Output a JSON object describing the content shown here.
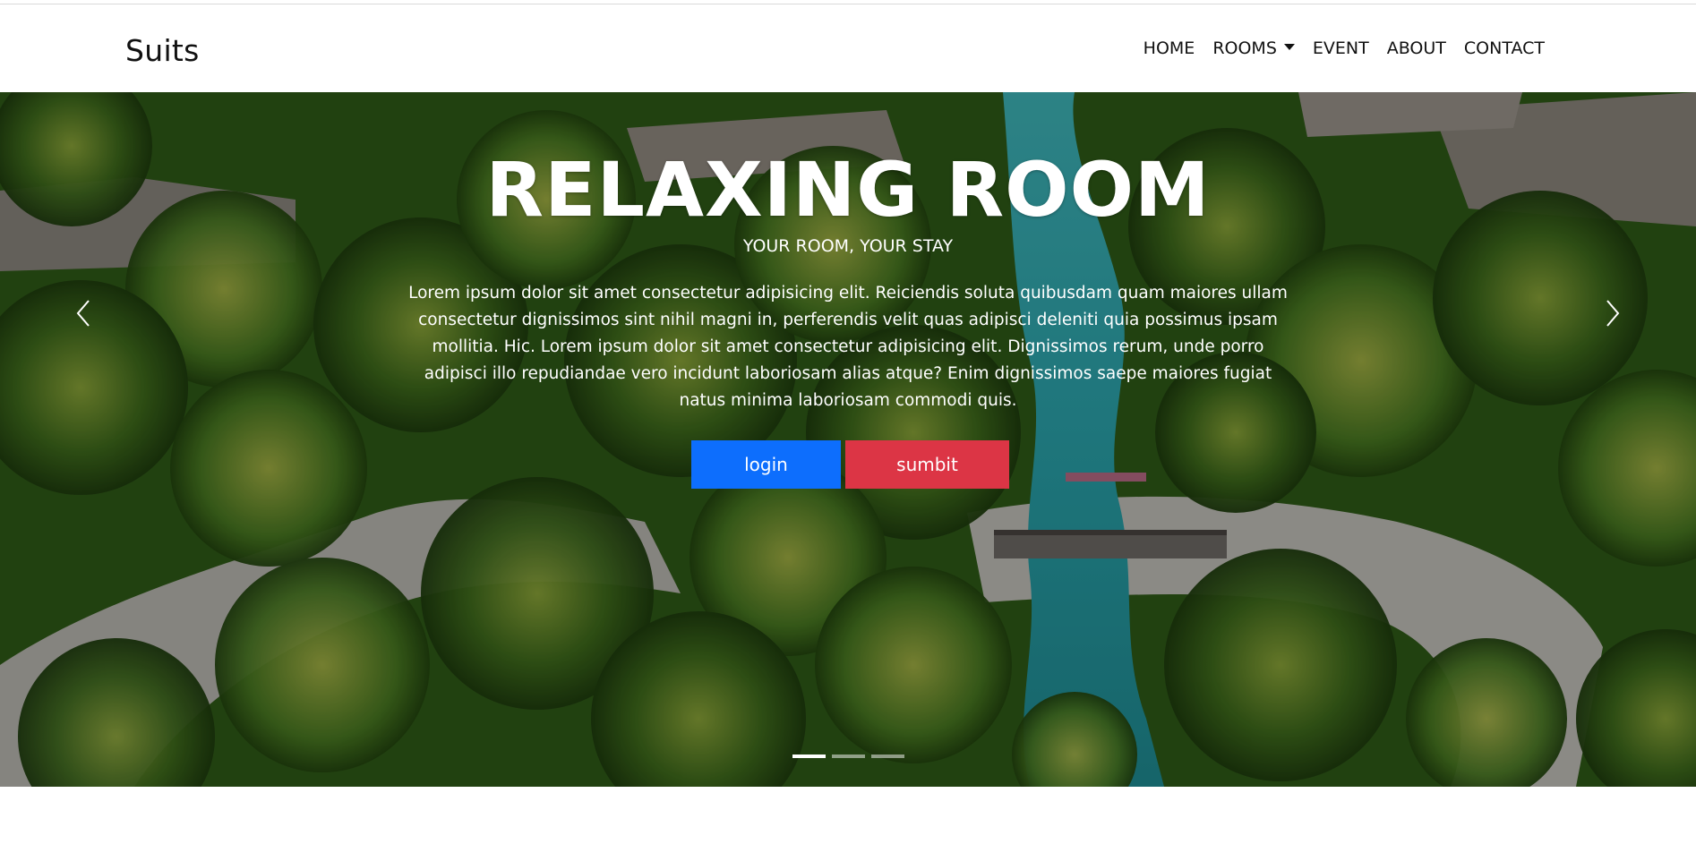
{
  "navbar": {
    "brand": "Suits",
    "items": [
      {
        "label": "HOME"
      },
      {
        "label": "ROOMS"
      },
      {
        "label": "EVENT"
      },
      {
        "label": "ABOUT"
      },
      {
        "label": "CONTACT"
      }
    ]
  },
  "hero": {
    "title": "RELAXING ROOM",
    "subtitle": "YOUR ROOM, YOUR STAY",
    "text": "Lorem ipsum dolor sit amet consectetur adipisicing elit. Reiciendis soluta quibusdam quam maiores ullam consectetur dignissimos sint nihil magni in, perferendis velit quas adipisci deleniti quia possimus ipsam mollitia. Hic. Lorem ipsum dolor sit amet consectetur adipisicing elit. Dignissimos rerum, unde porro adipisci illo repudiandae vero incidunt laboriosam alias atque? Enim dignissimos saepe maiores fugiat natus minima laboriosam commodi quis.",
    "buttons": {
      "login": "login",
      "submit": "sumbit"
    },
    "indicators": 3,
    "active_slide": 1
  },
  "colors": {
    "login_button": "#0d6efd",
    "submit_button": "#dc3545"
  },
  "icons": {
    "prev": "chevron-left-icon",
    "next": "chevron-right-icon",
    "rooms_dropdown": "caret-down-icon"
  }
}
